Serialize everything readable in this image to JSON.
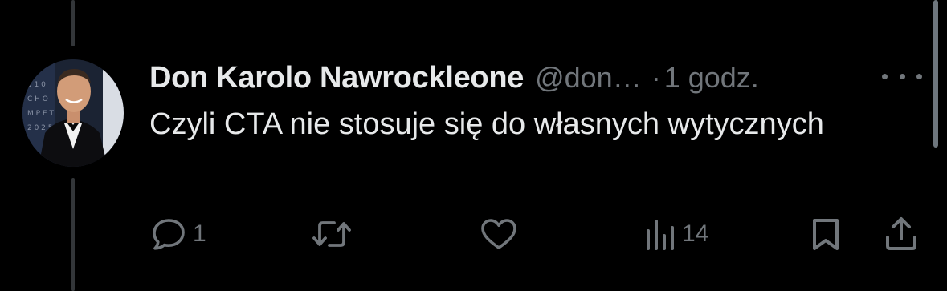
{
  "tweet": {
    "author": {
      "display_name": "Don Karolo Nawrockleone",
      "handle": "@don…",
      "avatar": "avatar-photo-man-in-tuxedo"
    },
    "separator": "·",
    "time": "1 godz.",
    "text": "Czyli CTA nie stosuje się do własnych wytycznych",
    "more_icon": "more-horizontal-icon",
    "actions": {
      "reply": {
        "icon": "reply-icon",
        "count": "1"
      },
      "retweet": {
        "icon": "retweet-icon",
        "count": ""
      },
      "like": {
        "icon": "heart-icon",
        "count": ""
      },
      "views": {
        "icon": "views-chart-icon",
        "count": "14"
      },
      "bookmark": {
        "icon": "bookmark-icon"
      },
      "share": {
        "icon": "share-icon"
      }
    }
  },
  "colors": {
    "background": "#000000",
    "primary_text": "#e7e9ea",
    "secondary_text": "#71767b",
    "thread_line": "#333639"
  }
}
